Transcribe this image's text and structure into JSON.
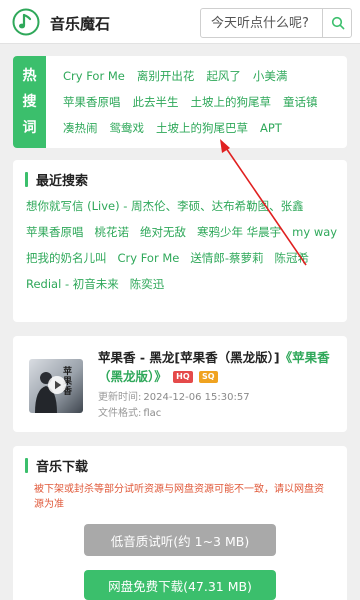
{
  "header": {
    "title": "音乐魔石",
    "search_placeholder": "今天听点什么呢?",
    "logo_icon": "music-note-icon",
    "search_icon": "search-icon"
  },
  "hot": {
    "side_label": [
      "热",
      "搜",
      "词"
    ],
    "tags": [
      "Cry For Me",
      "离别开出花",
      "起风了",
      "小美满",
      "苹果香原唱",
      "此去半生",
      "土坡上的狗尾草",
      "童话镇",
      "凑热闹",
      "鸳鸯戏",
      "土坡上的狗尾巴草",
      "APT"
    ]
  },
  "recent": {
    "title": "最近搜索",
    "tags": [
      "想你就写信 (Live) - 周杰伦、李硕、达布希勒图、张鑫",
      "苹果香原唱",
      "桃花诺",
      "绝对无敌",
      "寒鸦少年 华晨宇",
      "my way",
      "把我的奶名儿叫",
      "Cry For Me",
      "送情郎-蔡萝莉",
      "陈冠希",
      "Redial - 初音未来",
      "陈奕迅"
    ]
  },
  "song": {
    "title_main": "苹果香 - 黑龙[苹果香（黑龙版）]",
    "title_album": "《苹果香（黑龙版）》",
    "badge_hq": "HQ",
    "badge_sq": "SQ",
    "updated_label": "更新时间:",
    "updated_value": "2024-12-06 15:30:57",
    "format_label": "文件格式:",
    "format_value": "flac",
    "cover_text": "苹果香",
    "play_icon": "play-icon"
  },
  "download": {
    "title": "音乐下载",
    "note": "被下架或封杀等部分试听资源与网盘资源可能不一致，请以网盘资源为准",
    "low_button": "低音质试听(约 1~3 MB)",
    "pan_button": "网盘免费下载(47.31 MB)"
  },
  "colors": {
    "accent": "#3bbf6c",
    "tag_text": "#2fa85a",
    "warning": "#e0593a",
    "annotation": "#e02020"
  }
}
